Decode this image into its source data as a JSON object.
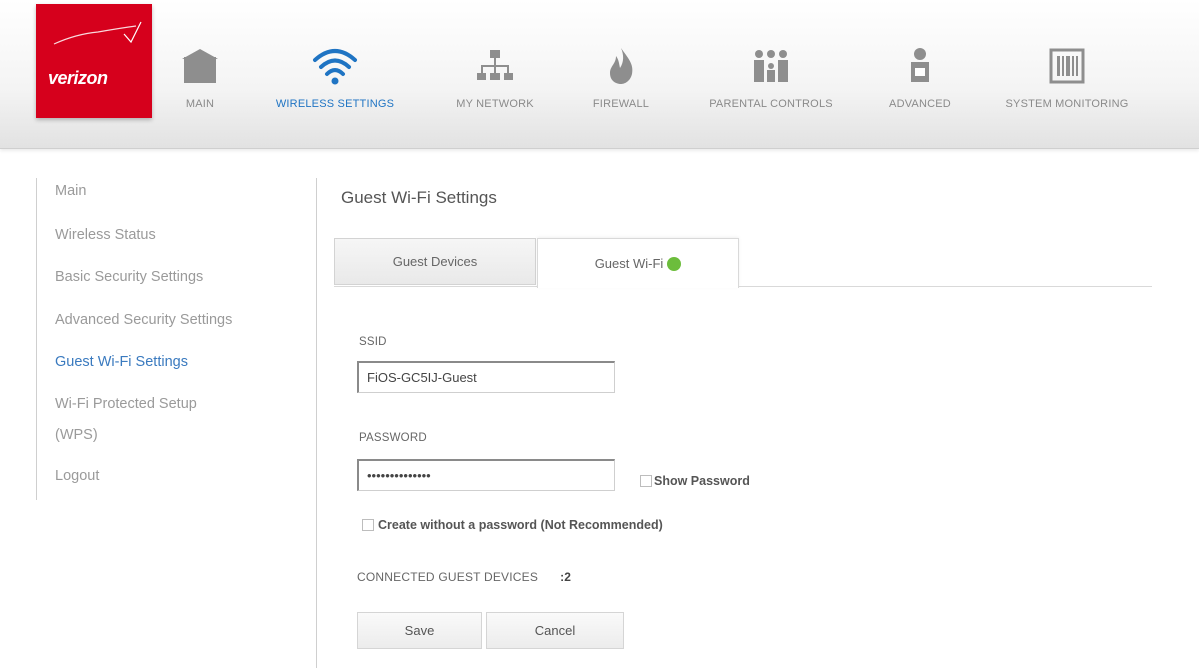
{
  "brand": {
    "name": "verizon",
    "color": "#d6001c"
  },
  "nav": {
    "items": [
      {
        "label": "MAIN",
        "icon": "home-icon"
      },
      {
        "label": "WIRELESS SETTINGS",
        "icon": "wifi-icon",
        "active": true
      },
      {
        "label": "MY NETWORK",
        "icon": "network-icon"
      },
      {
        "label": "FIREWALL",
        "icon": "flame-icon"
      },
      {
        "label": "PARENTAL CONTROLS",
        "icon": "family-icon"
      },
      {
        "label": "ADVANCED",
        "icon": "advanced-user-icon"
      },
      {
        "label": "SYSTEM MONITORING",
        "icon": "monitor-icon"
      }
    ],
    "active_color": "#1f74c3"
  },
  "sidebar": {
    "items": [
      {
        "label": "Main"
      },
      {
        "label": "Wireless Status"
      },
      {
        "label": "Basic Security Settings"
      },
      {
        "label": "Advanced Security Settings"
      },
      {
        "label": "Guest Wi-Fi Settings",
        "active": true
      },
      {
        "label": "Wi-Fi Protected Setup"
      },
      {
        "label": "(WPS)"
      },
      {
        "label": "Logout"
      }
    ],
    "active_color": "#3a7abf"
  },
  "main": {
    "title": "Guest Wi-Fi Settings",
    "tabs": [
      {
        "label": "Guest Devices"
      },
      {
        "label": "Guest Wi-Fi",
        "active": true,
        "status_color": "#6cbd3c"
      }
    ],
    "ssid": {
      "label": "SSID",
      "value": "FiOS-GC5IJ-Guest"
    },
    "password": {
      "label": "PASSWORD",
      "value": "••••••••••••••"
    },
    "show_password_label": "Show Password",
    "create_without_password_label": "Create without a password (Not Recommended)",
    "connected": {
      "label": "CONNECTED GUEST DEVICES",
      "value": ":2"
    },
    "save_label": "Save",
    "cancel_label": "Cancel"
  }
}
